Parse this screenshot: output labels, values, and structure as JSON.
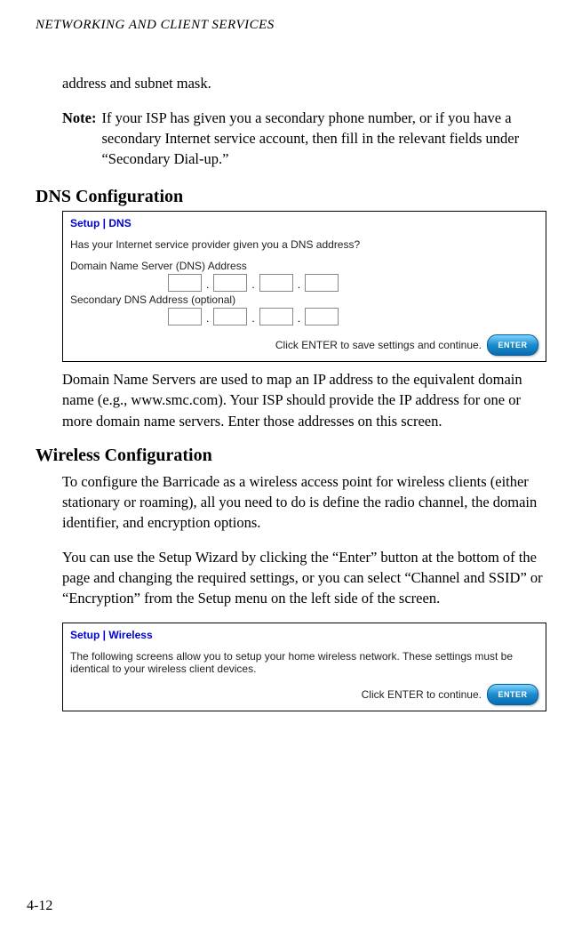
{
  "header": {
    "running_title": "NETWORKING AND CLIENT SERVICES"
  },
  "intro_continuation": "address and subnet mask.",
  "note": {
    "label": "Note:",
    "text": "If your ISP has given you a secondary phone number, or if you have a secondary Internet service account, then fill in the relevant fields under “Secondary Dial-up.”"
  },
  "dns_section": {
    "heading": "DNS Configuration",
    "setup": {
      "title": "Setup | DNS",
      "question": "Has your Internet service provider given you a DNS address?",
      "primary_label": "Domain Name Server (DNS) Address",
      "secondary_label": "Secondary DNS Address (optional)",
      "enter_caption": "Click ENTER to save settings and continue.",
      "enter_button": "ENTER"
    },
    "body": "Domain Name Servers are used to map an IP address to the equivalent domain name (e.g., www.smc.com). Your ISP should provide the IP address for one or more domain name servers. Enter those addresses on this screen."
  },
  "wireless_section": {
    "heading": "Wireless Configuration",
    "para1": "To configure the Barricade as a wireless access point for wireless clients (either stationary or roaming), all you need to do is define the radio channel, the domain identifier, and encryption options.",
    "para2": "You can use the Setup Wizard by clicking the “Enter” button at the bottom of the page and changing the required settings, or you can select “Channel and SSID” or “Encryption” from the Setup menu on the left side of the screen.",
    "setup": {
      "title": "Setup | Wireless",
      "text": "The following screens allow you to setup your home wireless network. These settings must be identical to your wireless client devices.",
      "enter_caption": "Click ENTER to continue.",
      "enter_button": "ENTER"
    }
  },
  "page_number": "4-12"
}
